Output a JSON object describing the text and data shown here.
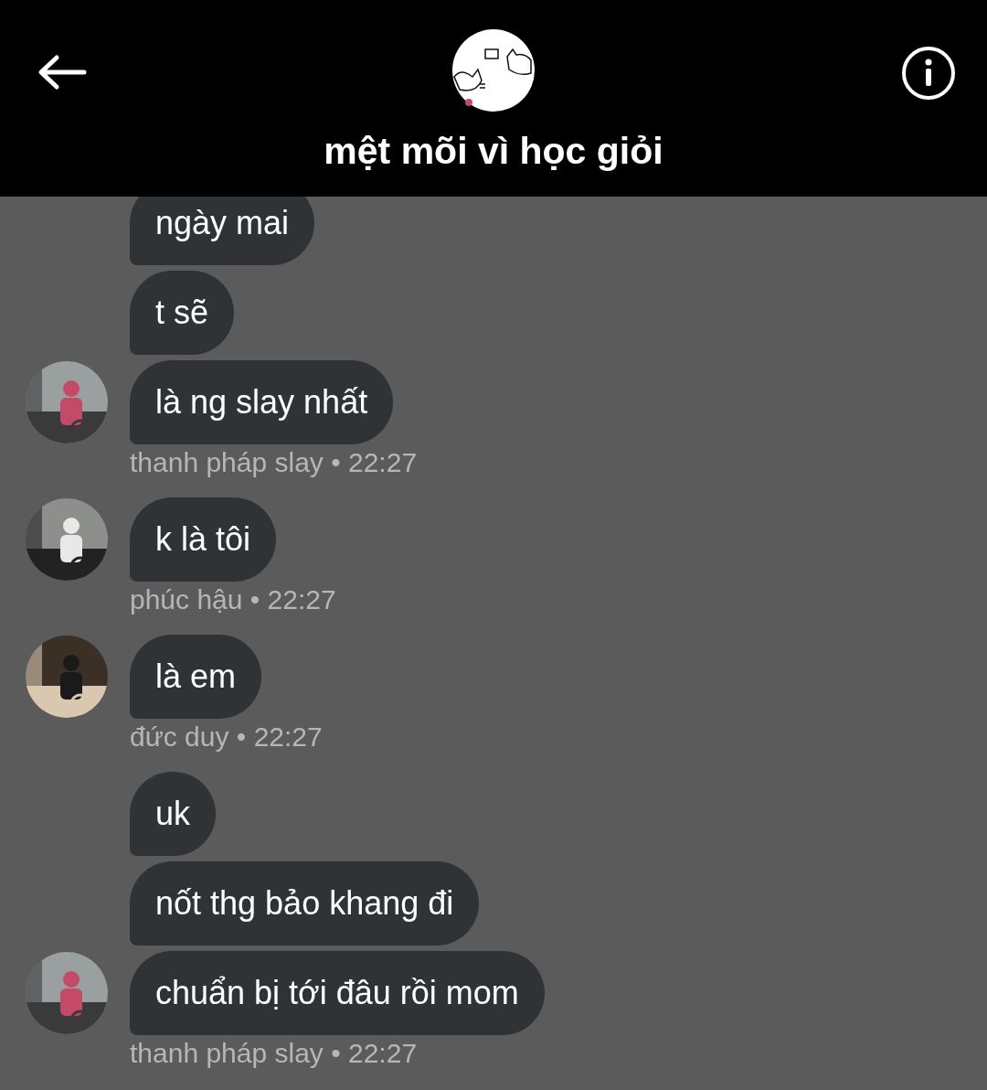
{
  "header": {
    "title": "mệt mõi vì học giỏi"
  },
  "groups": [
    {
      "messages": [
        "ngày mai",
        "t sẽ",
        "là ng slay nhất"
      ],
      "meta": "thanh pháp slay • 22:27"
    },
    {
      "messages": [
        "k là tôi"
      ],
      "meta": "phúc hậu • 22:27"
    },
    {
      "messages": [
        "là em"
      ],
      "meta": "đức duy • 22:27"
    },
    {
      "messages": [
        "uk",
        "nốt thg bảo khang đi",
        "chuẩn bị tới đâu rồi mom"
      ],
      "meta": "thanh pháp slay • 22:27"
    }
  ]
}
